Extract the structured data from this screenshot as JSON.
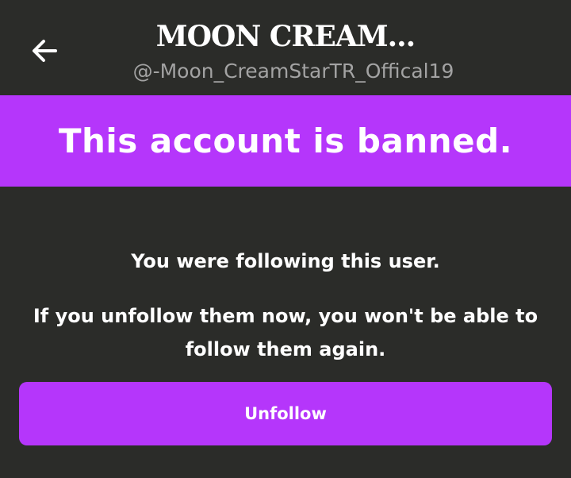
{
  "header": {
    "title": "MOON CREAM...",
    "handle": "@-Moon_CreamStarTR_Offical19",
    "back_icon": "arrow-left-icon"
  },
  "banner": {
    "text": "This account is banned.",
    "color": "#b536fb"
  },
  "message": {
    "line1": "You were following this user.",
    "line2": "If you unfollow them now, you won't be able to follow them again."
  },
  "unfollow_button": {
    "label": "Unfollow",
    "color": "#b536fb"
  },
  "colors": {
    "background": "#2b2c29",
    "text": "#ffffff",
    "handle_text": "#a3a3a3"
  }
}
